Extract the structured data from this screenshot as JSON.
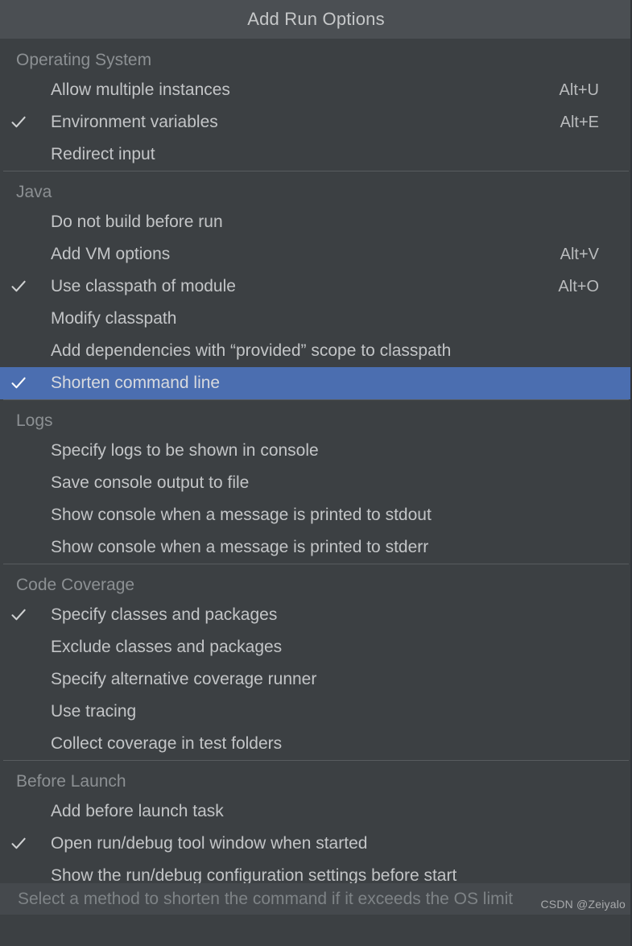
{
  "window": {
    "title": "Add Run Options",
    "accent_color": "#4b6eb0",
    "background_color": "#3c4043",
    "titlebar_color": "#4b4f53",
    "text_color": "#c3c5c7",
    "muted_text_color": "#8c9093"
  },
  "groups": [
    {
      "header": "Operating System",
      "items": [
        {
          "label": "Allow multiple instances",
          "shortcut": "Alt+U",
          "checked": false,
          "selected": false
        },
        {
          "label": "Environment variables",
          "shortcut": "Alt+E",
          "checked": true,
          "selected": false
        },
        {
          "label": "Redirect input",
          "shortcut": "",
          "checked": false,
          "selected": false
        }
      ]
    },
    {
      "header": "Java",
      "items": [
        {
          "label": "Do not build before run",
          "shortcut": "",
          "checked": false,
          "selected": false
        },
        {
          "label": "Add VM options",
          "shortcut": "Alt+V",
          "checked": false,
          "selected": false
        },
        {
          "label": "Use classpath of module",
          "shortcut": "Alt+O",
          "checked": true,
          "selected": false
        },
        {
          "label": "Modify classpath",
          "shortcut": "",
          "checked": false,
          "selected": false
        },
        {
          "label": "Add dependencies with “provided” scope to classpath",
          "shortcut": "",
          "checked": false,
          "selected": false
        },
        {
          "label": "Shorten command line",
          "shortcut": "",
          "checked": true,
          "selected": true
        }
      ]
    },
    {
      "header": "Logs",
      "items": [
        {
          "label": "Specify logs to be shown in console",
          "shortcut": "",
          "checked": false,
          "selected": false
        },
        {
          "label": "Save console output to file",
          "shortcut": "",
          "checked": false,
          "selected": false
        },
        {
          "label": "Show console when a message is printed to stdout",
          "shortcut": "",
          "checked": false,
          "selected": false
        },
        {
          "label": "Show console when a message is printed to stderr",
          "shortcut": "",
          "checked": false,
          "selected": false
        }
      ]
    },
    {
      "header": "Code Coverage",
      "items": [
        {
          "label": "Specify classes and packages",
          "shortcut": "",
          "checked": true,
          "selected": false
        },
        {
          "label": "Exclude classes and packages",
          "shortcut": "",
          "checked": false,
          "selected": false
        },
        {
          "label": "Specify alternative coverage runner",
          "shortcut": "",
          "checked": false,
          "selected": false
        },
        {
          "label": "Use tracing",
          "shortcut": "",
          "checked": false,
          "selected": false
        },
        {
          "label": "Collect coverage in test folders",
          "shortcut": "",
          "checked": false,
          "selected": false
        }
      ]
    },
    {
      "header": "Before Launch",
      "items": [
        {
          "label": "Add before launch task",
          "shortcut": "",
          "checked": false,
          "selected": false
        },
        {
          "label": "Open run/debug tool window when started",
          "shortcut": "",
          "checked": true,
          "selected": false
        },
        {
          "label": "Show the run/debug configuration settings before start",
          "shortcut": "",
          "checked": false,
          "selected": false
        }
      ]
    }
  ],
  "footer": {
    "hint": "Select a method to shorten the command if it exceeds the OS limit"
  },
  "watermark": {
    "text": "CSDN @Zeiyalo"
  },
  "icons": {
    "checkmark": "check-icon"
  }
}
